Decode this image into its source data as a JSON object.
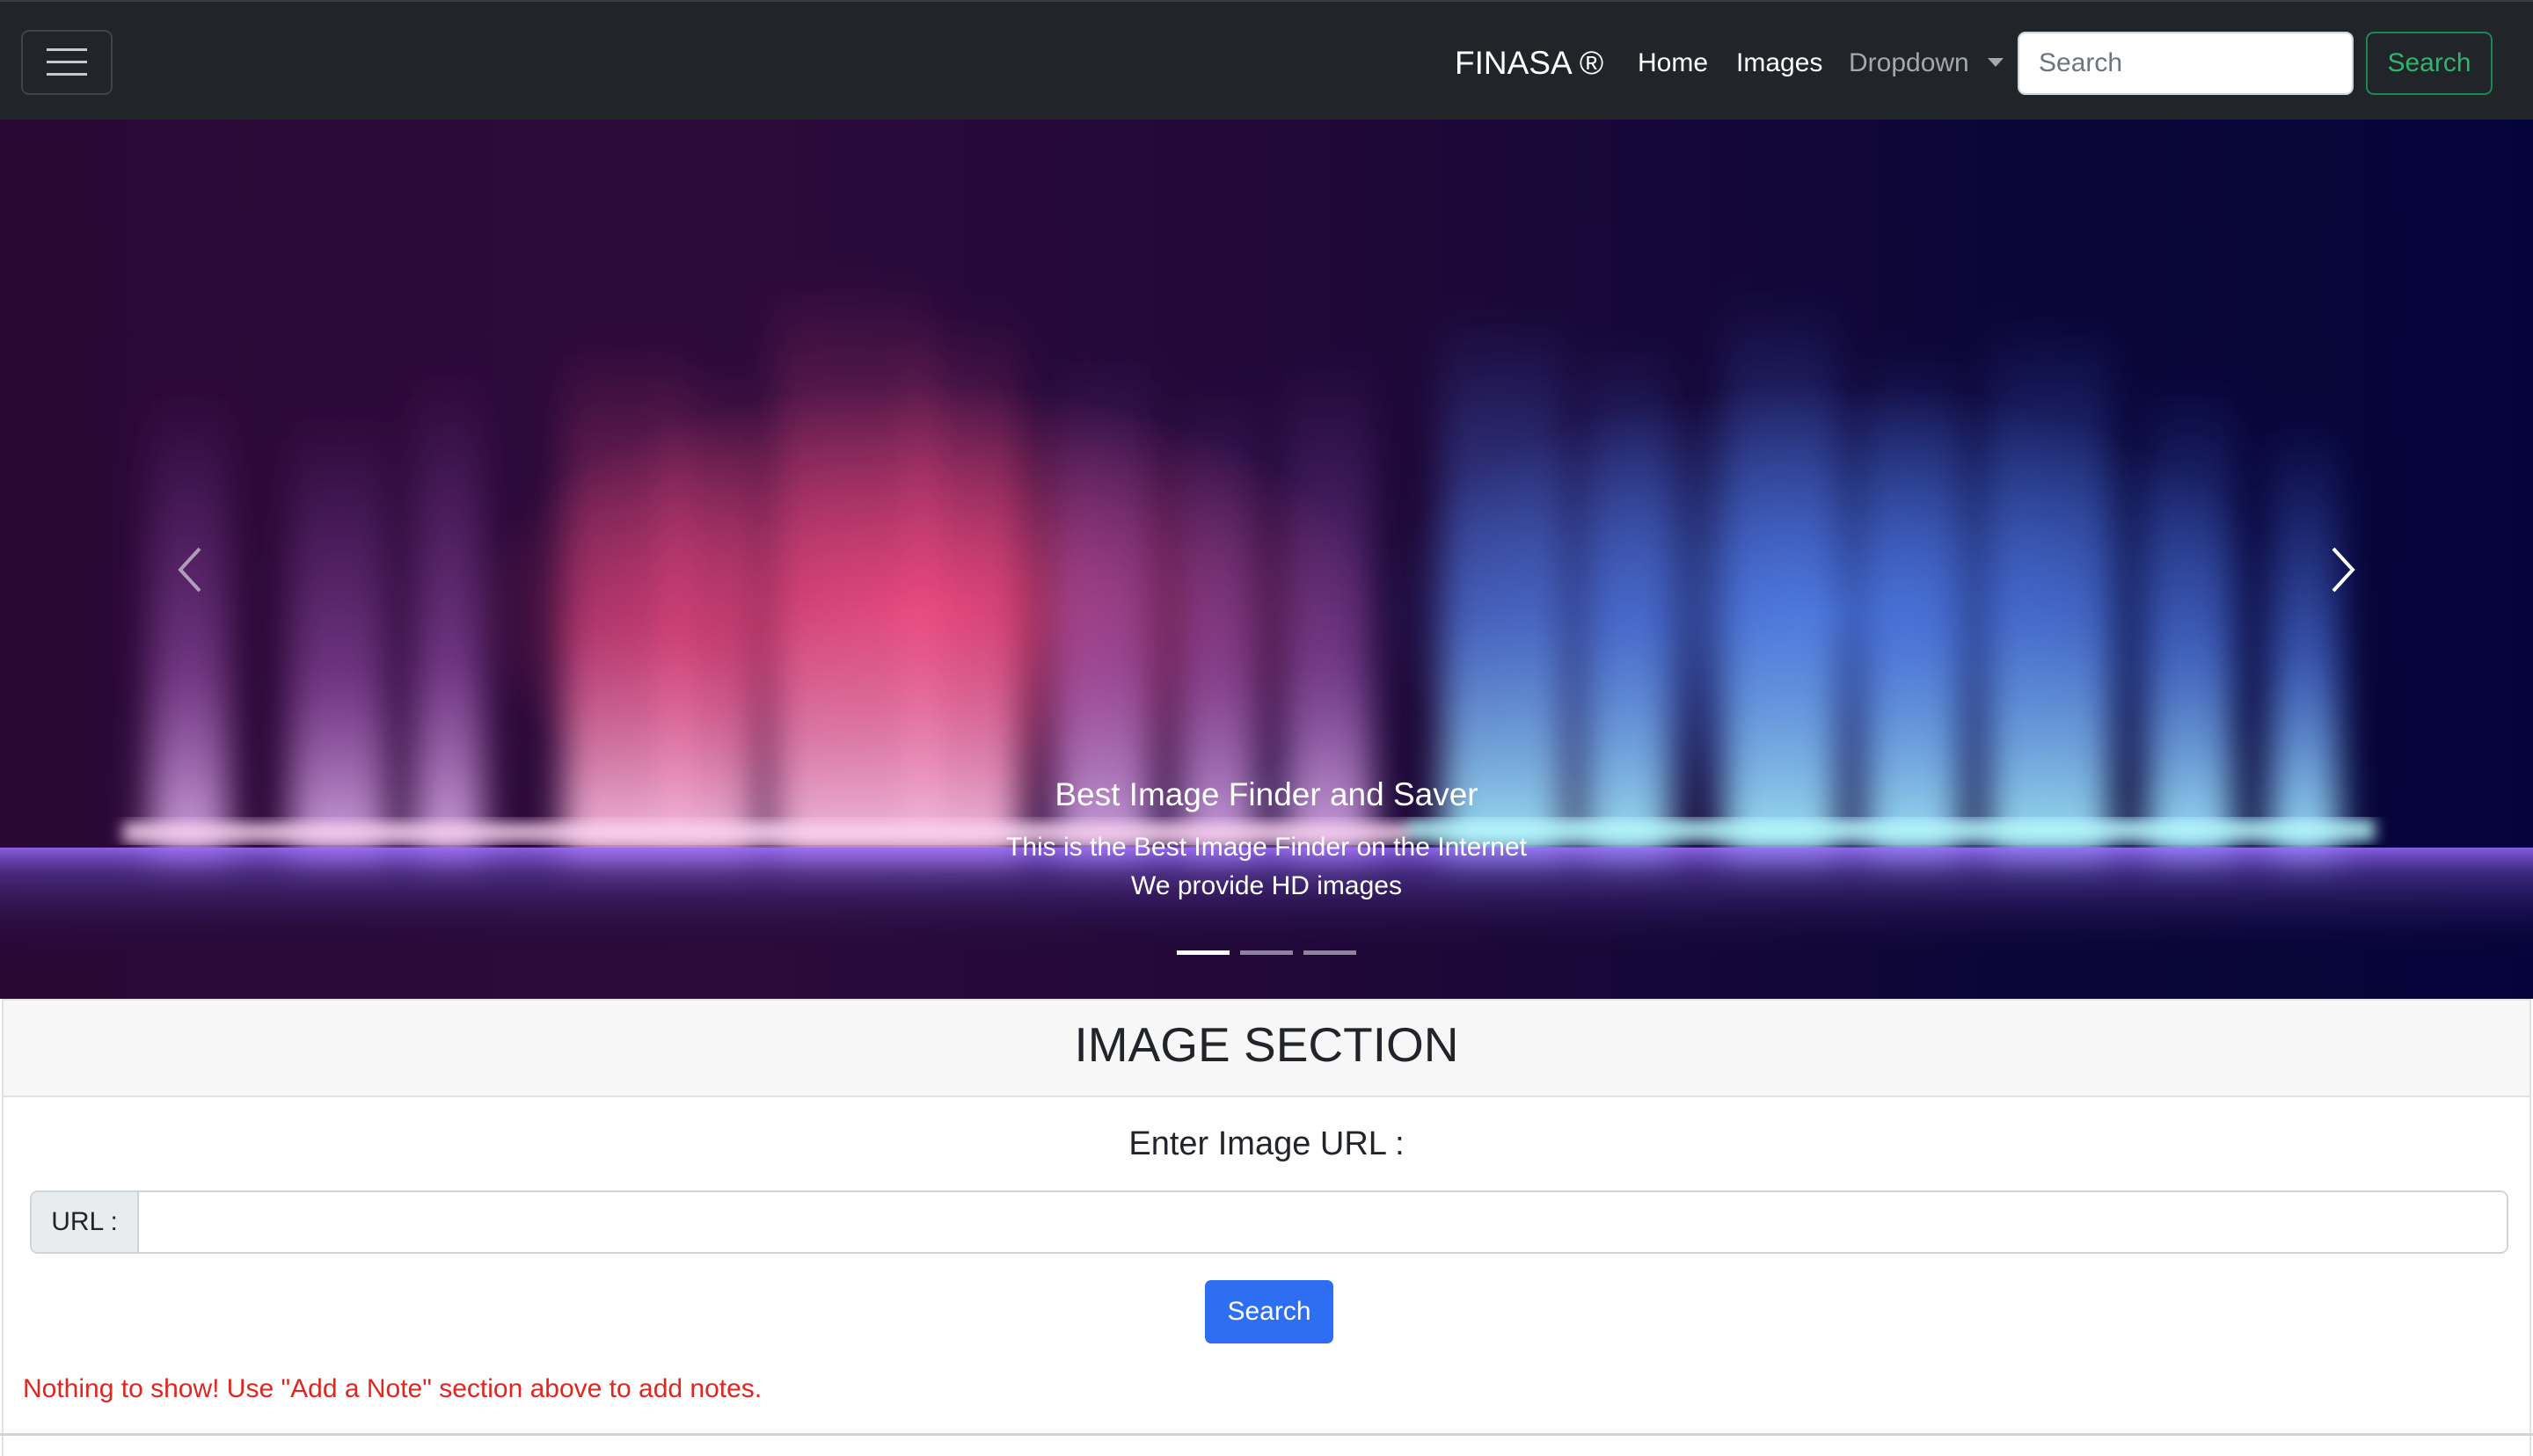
{
  "navbar": {
    "brand": "FINASA ®",
    "links": [
      {
        "label": "Home"
      },
      {
        "label": "Images"
      },
      {
        "label": "Dropdown"
      }
    ],
    "search": {
      "placeholder": "Search",
      "value": "",
      "button_label": "Search"
    }
  },
  "carousel": {
    "caption_title": "Best Image Finder and Saver",
    "caption_line1": "This is the Best Image Finder on the Internet",
    "caption_line2": "We provide HD images",
    "slide_count": 3,
    "active_slide": 1,
    "prev_icon": "chevron-left-icon",
    "next_icon": "chevron-right-icon"
  },
  "image_section": {
    "title": "IMAGE SECTION",
    "prompt": "Enter Image URL :",
    "url_label": "URL :",
    "url_value": "",
    "search_button": "Search",
    "empty_message": "Nothing to show! Use \"Add a Note\" section above to add notes."
  },
  "colors": {
    "navbar_bg": "#212529",
    "primary": "#2d6ef2",
    "success_outline": "#198754",
    "danger_text": "#e0261f"
  }
}
